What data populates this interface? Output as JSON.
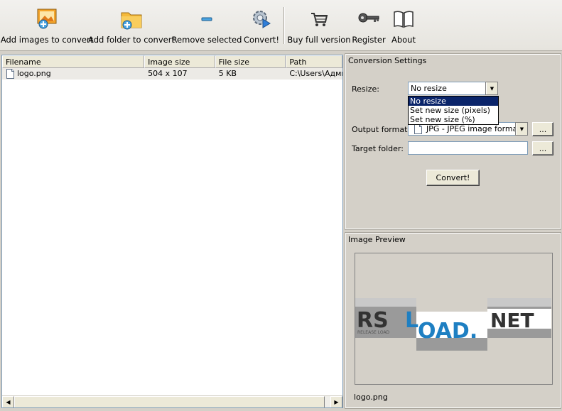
{
  "toolbar": {
    "buttons": [
      {
        "label": "Add images to convert",
        "icon": "add-images-icon"
      },
      {
        "label": "Add folder to convert",
        "icon": "add-folder-icon"
      },
      {
        "label": "Remove selected",
        "icon": "remove-icon"
      },
      {
        "label": "Convert!",
        "icon": "convert-gear-icon"
      },
      {
        "label": "Buy full version",
        "icon": "cart-icon"
      },
      {
        "label": "Register",
        "icon": "key-icon"
      },
      {
        "label": "About",
        "icon": "book-icon"
      }
    ]
  },
  "file_list": {
    "columns": [
      "Filename",
      "Image size",
      "File size",
      "Path"
    ],
    "rows": [
      {
        "filename": "logo.png",
        "image_size": "504 x 107",
        "file_size": "5 KB",
        "path": "C:\\Users\\Адми"
      }
    ]
  },
  "conversion": {
    "title": "Conversion Settings",
    "resize_label": "Resize:",
    "resize_value": "No resize",
    "resize_options": [
      "No resize",
      "Set new size (pixels)",
      "Set new size (%)"
    ],
    "output_format_label": "Output format:",
    "output_format_value": "JPG - JPEG image format",
    "target_folder_label": "Target folder:",
    "target_folder_value": "",
    "browse_label": "...",
    "convert_label": "Convert!"
  },
  "preview": {
    "title": "Image Preview",
    "caption": "logo.png",
    "logo_parts": [
      "RSL",
      "OAD.",
      "NET"
    ],
    "logo_tagline": "RELEASE LOAD"
  },
  "colors": {
    "window_bg": "#d4d0c8",
    "selection": "#0a246a",
    "logo_blue": "#1e7fc2",
    "logo_dark": "#333333"
  }
}
